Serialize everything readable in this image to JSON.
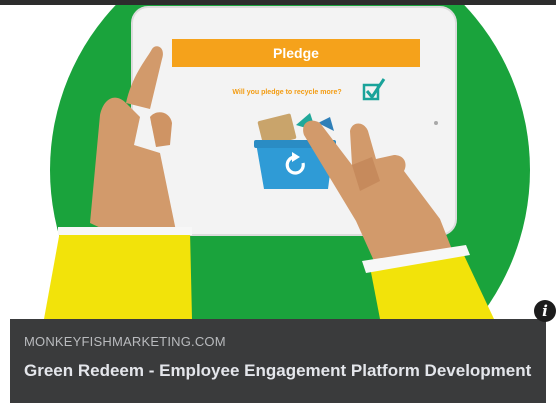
{
  "link_preview": {
    "image": {
      "header_label": "Pledge",
      "question": "Will you pledge to recycle more?"
    },
    "domain": "MONKEYFISHMARKETING.COM",
    "title": "Green Redeem - Employee Engagement Platform Development",
    "info_glyph": "i"
  },
  "colors": {
    "background": "#ffffff",
    "green_circle": "#1aa33c",
    "tablet": "#f3f3f3",
    "pledge_bar": "#f5a21b",
    "question_text": "#f39c12",
    "bin": "#2f9bd6",
    "skin": "#d29a6b",
    "sleeve": "#f2e30a",
    "meta_panel": "#3a3b3c",
    "domain_text": "#b9bbbe",
    "title_text": "#e4e6eb"
  },
  "icons": {
    "checkbox": "checkbox-tick-icon",
    "recycle": "recycle-arrow-icon",
    "info": "info-icon"
  }
}
